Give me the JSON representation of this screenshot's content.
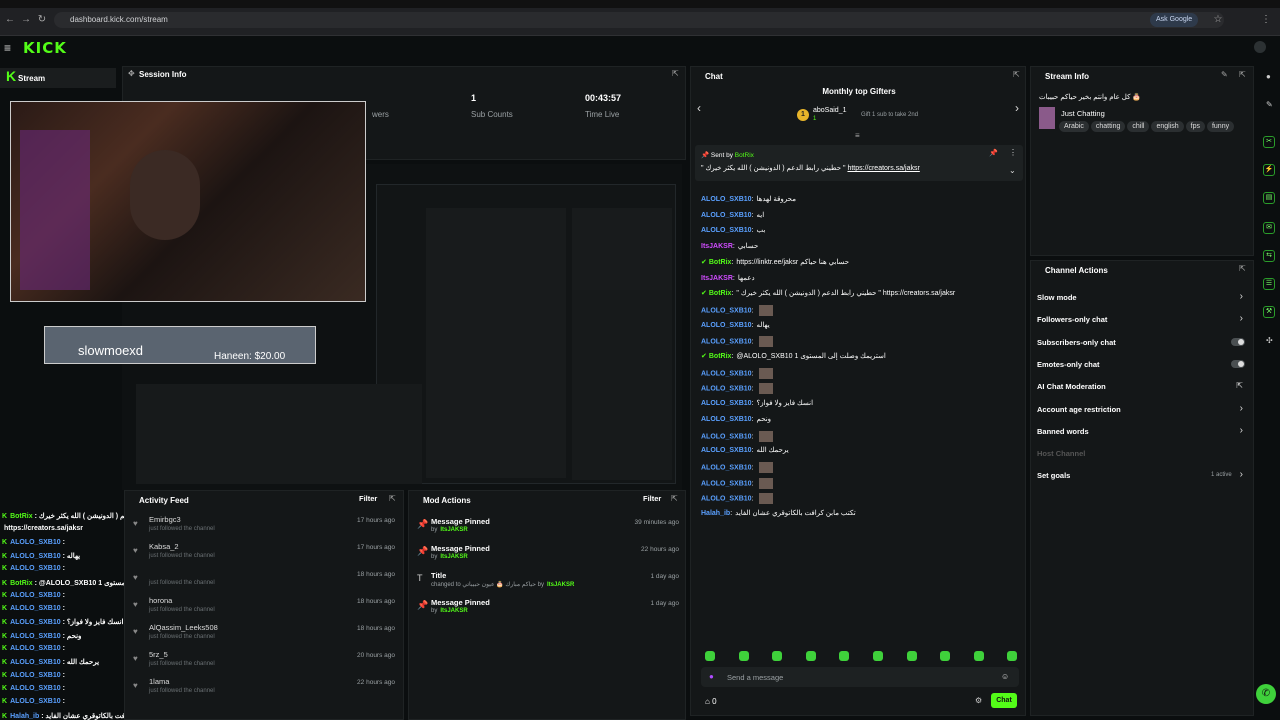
{
  "browser": {
    "url": "dashboard.kick.com/stream",
    "ask_google": "Ask Google"
  },
  "app": {
    "logo": "KICK",
    "stream_label": "Stream"
  },
  "session": {
    "title": "Session Info",
    "followers_label": "wers",
    "sub_count_value": "1",
    "sub_count_label": "Sub Counts",
    "time_value": "00:43:57",
    "time_label": "Time Live"
  },
  "overlay": {
    "username": "slowmoexd",
    "donation": "Haneen: $20.00"
  },
  "chat": {
    "title": "Chat",
    "top_gifters_title": "Monthly top Gifters",
    "gifter_rank": "1",
    "gifter_name": "aboSaid_1",
    "gifter_count": "1",
    "gifter_note": "Gift 1 sub to take 2nd",
    "pinned_sent_by": "Sent by",
    "pinned_user": "BotRix",
    "pinned_text": "\" حطيني رابط الدعم ( الدونيشن ) الله يكثر خيرك \"",
    "pinned_link": "https://creators.sa/jaksr",
    "messages": [
      {
        "user": "ALOLO_SXB10",
        "sep": ":",
        "text": "محروقة لهدها"
      },
      {
        "user": "ALOLO_SXB10",
        "sep": ":",
        "text": "ايه"
      },
      {
        "user": "ALOLO_SXB10",
        "sep": ":",
        "text": "بب"
      },
      {
        "user": "ItsJAKSR",
        "sep": ":",
        "text": "حسابي"
      },
      {
        "user": "BotRix",
        "sep": ":",
        "text": "https://linktr.ee/jaksr  حسابي هنا حياكم"
      },
      {
        "user": "ItsJAKSR",
        "sep": ":",
        "text": "دعمها"
      },
      {
        "user": "BotRix",
        "sep": ":",
        "text": "\" حطيني رابط الدعم ( الدونيشن ) الله يكثر خيرك \"  https://creators.sa/jaksr"
      },
      {
        "user": "ALOLO_SXB10",
        "sep": ":",
        "text": ""
      },
      {
        "user": "ALOLO_SXB10",
        "sep": ":",
        "text": "يهاله"
      },
      {
        "user": "ALOLO_SXB10",
        "sep": ":",
        "text": ""
      },
      {
        "user": "BotRix",
        "sep": ":",
        "text": "@ALOLO_SXB10 1 استريمك وصلت إلى المستوى"
      },
      {
        "user": "ALOLO_SXB10",
        "sep": ":",
        "text": ""
      },
      {
        "user": "ALOLO_SXB10",
        "sep": ":",
        "text": ""
      },
      {
        "user": "ALOLO_SXB10",
        "sep": ":",
        "text": "انسك فايز ولا فواز؟"
      },
      {
        "user": "ALOLO_SXB10",
        "sep": ":",
        "text": "ونحم"
      },
      {
        "user": "ALOLO_SXB10",
        "sep": ":",
        "text": ""
      },
      {
        "user": "ALOLO_SXB10",
        "sep": ":",
        "text": "يرحمك الله"
      },
      {
        "user": "ALOLO_SXB10",
        "sep": ":",
        "text": ""
      },
      {
        "user": "ALOLO_SXB10",
        "sep": ":",
        "text": ""
      },
      {
        "user": "ALOLO_SXB10",
        "sep": ":",
        "text": ""
      },
      {
        "user": "Halah_ib",
        "sep": ":",
        "text": "تكتب مابن كرافت بالكاتوقري عشان الفايد"
      }
    ],
    "input_placeholder": "Send a message",
    "count": "0",
    "send_label": "Chat"
  },
  "stream_info": {
    "title": "Stream Info",
    "stream_title": "كل عام وانتم بخير حياكم حبيبات 🎂",
    "category": "Just Chatting",
    "tags": [
      "Arabic",
      "chatting",
      "chill",
      "english",
      "fps",
      "funny"
    ]
  },
  "channel_actions": {
    "title": "Channel Actions",
    "items": [
      {
        "label": "Slow mode",
        "control": "caret"
      },
      {
        "label": "Followers-only chat",
        "control": "caret"
      },
      {
        "label": "Subscribers-only chat",
        "control": "toggle"
      },
      {
        "label": "Emotes-only chat",
        "control": "toggle"
      },
      {
        "label": "AI Chat Moderation",
        "control": "external"
      },
      {
        "label": "Account age restriction",
        "control": "caret"
      },
      {
        "label": "Banned words",
        "control": "caret"
      },
      {
        "label": "Host Channel",
        "control": "none"
      },
      {
        "label": "Set goals",
        "control": "caret"
      }
    ],
    "goals_status": "1 active"
  },
  "activity": {
    "title": "Activity Feed",
    "filter": "Filter",
    "items": [
      {
        "name": "Emirbgc3",
        "sub": "just followed the channel",
        "time": "17 hours ago"
      },
      {
        "name": "Kabsa_2",
        "sub": "just followed the channel",
        "time": "17 hours ago"
      },
      {
        "name": "",
        "sub": "just followed the channel",
        "time": "18 hours ago"
      },
      {
        "name": "horona",
        "sub": "just followed the channel",
        "time": "18 hours ago"
      },
      {
        "name": "AlQassim_Leeks508",
        "sub": "just followed the channel",
        "time": "18 hours ago"
      },
      {
        "name": "5rz_5",
        "sub": "just followed the channel",
        "time": "20 hours ago"
      },
      {
        "name": "1lama",
        "sub": "just followed the channel",
        "time": "22 hours ago"
      }
    ]
  },
  "mod": {
    "title": "Mod Actions",
    "filter": "Filter",
    "items": [
      {
        "name": "Message Pinned",
        "sub": "by",
        "by": "ItsJAKSR",
        "time": "39 minutes ago"
      },
      {
        "name": "Message Pinned",
        "sub": "by",
        "by": "ItsJAKSR",
        "time": "22 hours ago"
      },
      {
        "name": "Title",
        "sub": "changed to حياكم مبارك 🎂 عيون حبيباتي by",
        "by": "ItsJAKSR",
        "time": "1 day ago"
      },
      {
        "name": "Message Pinned",
        "sub": "by",
        "by": "ItsJAKSR",
        "time": "1 day ago"
      }
    ]
  },
  "overlay_chat": [
    {
      "user": "BotRix",
      "text": ":  حطيني رابط الدعم ( الدونيشن ) الله يكثر خيرك"
    },
    {
      "user": "",
      "text": "https://creators.sa/jaksr"
    },
    {
      "user": "ALOLO_SXB10",
      "text": ":"
    },
    {
      "user": "ALOLO_SXB10",
      "text": ": يهاله"
    },
    {
      "user": "ALOLO_SXB10",
      "text": ":"
    },
    {
      "user": "BotRix",
      "text": ": @ALOLO_SXB10 استريمك وصلت إلى المستوى 1"
    },
    {
      "user": "ALOLO_SXB10",
      "text": ":"
    },
    {
      "user": "ALOLO_SXB10",
      "text": ":"
    },
    {
      "user": "ALOLO_SXB10",
      "text": ": انسك فايز ولا فواز؟"
    },
    {
      "user": "ALOLO_SXB10",
      "text": ": ونحم"
    },
    {
      "user": "ALOLO_SXB10",
      "text": ":"
    },
    {
      "user": "ALOLO_SXB10",
      "text": ": يرحمك الله"
    },
    {
      "user": "ALOLO_SXB10",
      "text": ":"
    },
    {
      "user": "ALOLO_SXB10",
      "text": ":"
    },
    {
      "user": "ALOLO_SXB10",
      "text": ":"
    },
    {
      "user": "Halah_ib",
      "text": ": تكتب مابن كرافت بالكاتوقري عشان الفايد"
    }
  ],
  "colors": {
    "accent": "#53fc18",
    "bg": "#0b0e0f",
    "panel": "#141718",
    "username": "#5aa0ff"
  }
}
